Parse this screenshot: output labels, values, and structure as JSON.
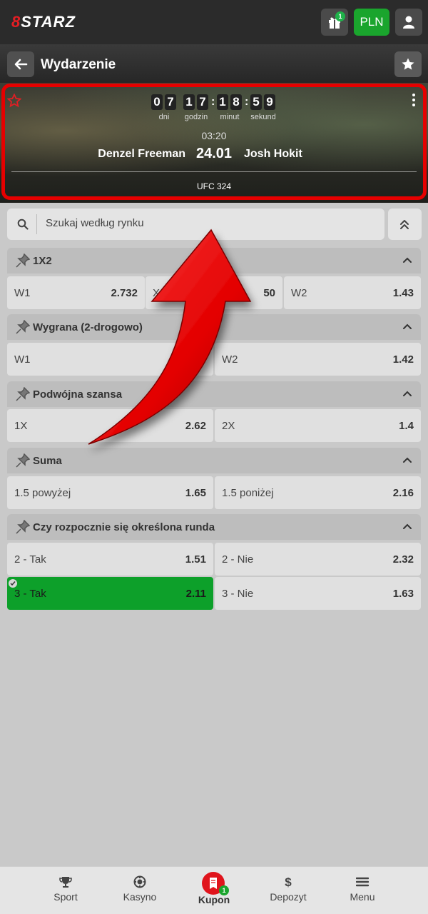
{
  "topbar": {
    "logo_prefix": "8",
    "logo_text": "STARZ",
    "gift_badge": "1",
    "currency": "PLN"
  },
  "subheader": {
    "title": "Wydarzenie"
  },
  "event": {
    "timer": {
      "digits": [
        "0",
        "7",
        "1",
        "7",
        "1",
        "8",
        "5",
        "9"
      ],
      "labels": [
        "dni",
        "godzin",
        "minut",
        "sekund"
      ]
    },
    "time": "03:20",
    "team1": "Denzel Freeman",
    "date": "24.01",
    "team2": "Josh Hokit",
    "league": "UFC 324"
  },
  "search": {
    "placeholder": "Szukaj według rynku"
  },
  "markets": [
    {
      "title": "1X2",
      "odds": [
        {
          "label": "W1",
          "value": "2.732"
        },
        {
          "label": "X",
          "value": "50"
        },
        {
          "label": "W2",
          "value": "1.43"
        }
      ]
    },
    {
      "title": "Wygrana (2-drogowo)",
      "odds": [
        {
          "label": "W1",
          "value": ""
        },
        {
          "label": "W2",
          "value": "1.42"
        }
      ]
    },
    {
      "title": "Podwójna szansa",
      "odds": [
        {
          "label": "1X",
          "value": "2.62"
        },
        {
          "label": "2X",
          "value": "1.4"
        }
      ]
    },
    {
      "title": "Suma",
      "odds": [
        {
          "label": "1.5 powyżej",
          "value": "1.65"
        },
        {
          "label": "1.5 poniżej",
          "value": "2.16"
        }
      ]
    },
    {
      "title": "Czy rozpocznie się określona runda",
      "odds": [
        {
          "label": "2 - Tak",
          "value": "1.51"
        },
        {
          "label": "2 - Nie",
          "value": "2.32"
        },
        {
          "label": "3 - Tak",
          "value": "2.11"
        },
        {
          "label": "3 - Nie",
          "value": "1.63"
        }
      ]
    }
  ],
  "bottom_nav": {
    "items": [
      "Sport",
      "Kasyno",
      "Kupon",
      "Depozyt",
      "Menu"
    ],
    "kupon_badge": "1"
  },
  "colors": {
    "accent_green": "#1aa52d",
    "brand_red": "#e31e24",
    "highlight_red": "#e60000"
  }
}
